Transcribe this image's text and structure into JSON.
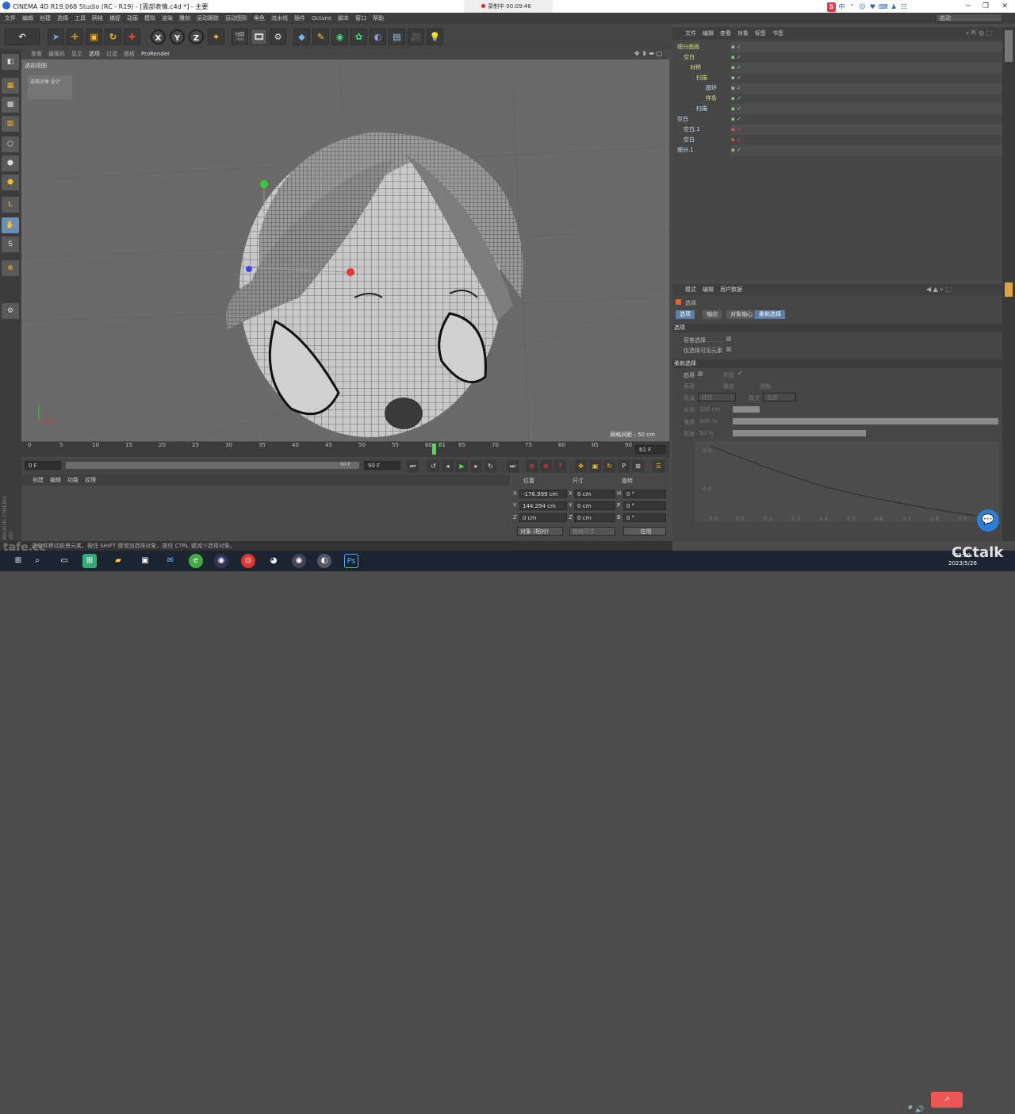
{
  "window": {
    "title": "CINEMA 4D R19.068 Studio (RC - R19) - [面部表情.c4d *] - 主要",
    "recording": "录制中 00:09:46"
  },
  "ime": {
    "items": [
      "S",
      "中",
      "°",
      "☺",
      "♥",
      "⌨",
      "♟",
      "☷",
      "☺"
    ]
  },
  "menu": [
    "文件",
    "编辑",
    "创建",
    "选择",
    "工具",
    "网格",
    "捕捉",
    "动画",
    "模拟",
    "渲染",
    "雕刻",
    "运动跟踪",
    "运动图形",
    "角色",
    "流水线",
    "插件",
    "Octane",
    "脚本",
    "窗口",
    "帮助"
  ],
  "layout_label": "启动",
  "toolbar": {
    "x": "X",
    "y": "Y",
    "z": "Z"
  },
  "viewport": {
    "menu": [
      "查看",
      "摄像机",
      "显示",
      "选项",
      "过滤",
      "面板",
      "ProRender"
    ],
    "active_menu": "选项",
    "label": "透视视图",
    "select_box": "选取对象 全计",
    "grid": "网格间距 : 50 cm"
  },
  "timeline": {
    "ticks": [
      "0",
      "5",
      "10",
      "15",
      "20",
      "25",
      "30",
      "35",
      "40",
      "45",
      "50",
      "55",
      "60",
      "61",
      "65",
      "70",
      "75",
      "80",
      "85",
      "90"
    ],
    "current": "61 F",
    "start": "0 F",
    "end": "90 F",
    "range_end": "90 F"
  },
  "bottom": {
    "tabs": [
      "创建",
      "编辑",
      "功能",
      "纹理"
    ]
  },
  "coords": {
    "headers": [
      "位置",
      "尺寸",
      "旋转"
    ],
    "pos": [
      "-176.999 cm",
      "144.294 cm",
      "0 cm"
    ],
    "size": [
      "0 cm",
      "0 cm",
      "0 cm"
    ],
    "rot": [
      "0 °",
      "0 °",
      "0 °"
    ],
    "axes": [
      "X",
      "Y",
      "Z"
    ],
    "rot_axes": [
      "H",
      "P",
      "B"
    ],
    "mode": "对象 (相对)",
    "size_mode": "绝对尺寸",
    "apply": "应用"
  },
  "status": "选取并移动前景元素，按住 SHIFT 键增加选择对象，按住 CTRL 键减少选择对象。",
  "objects": {
    "tabs": [
      "文件",
      "编辑",
      "查看",
      "对象",
      "标签",
      "书签"
    ],
    "rows": [
      {
        "name": "细分曲面",
        "indent": 0
      },
      {
        "name": "空白",
        "indent": 1
      },
      {
        "name": "对称",
        "indent": 2
      },
      {
        "name": "扫描",
        "indent": 3
      },
      {
        "name": "圆环",
        "indent": 4
      },
      {
        "name": "样条",
        "indent": 4
      },
      {
        "name": "扫描",
        "indent": 3
      },
      {
        "name": "空白",
        "indent": 0
      },
      {
        "name": "空白.1",
        "indent": 1
      },
      {
        "name": "空白",
        "indent": 1
      },
      {
        "name": "细分.1",
        "indent": 0
      }
    ]
  },
  "attributes": {
    "tabs": [
      "模式",
      "编辑",
      "用户数据"
    ],
    "title": "选择",
    "subtabs": [
      "选项",
      "轴向",
      "对象轴心",
      "柔和选择"
    ],
    "active_subtab": "柔和选择",
    "section1": "选项",
    "opt1": "容差选择 . . . . .",
    "opt2": "仅选择可见元素",
    "section2": "柔和选择",
    "r1": [
      "启用",
      "预览"
    ],
    "r2": [
      "表面",
      "橡皮",
      "限制"
    ],
    "mode": "模式",
    "mode_val": "全部",
    "falloff": "衰减",
    "falloff_val": "线性",
    "radius": "半径",
    "radius_val": "100 cm",
    "strength": "强度",
    "strength_val": "100 %",
    "width": "宽度",
    "width_val": "50 %",
    "strength_fill": 1.0,
    "width_fill": 0.5,
    "graph_y": [
      "0.8",
      "0.4"
    ],
    "graph_x": [
      "0.0",
      "0.1",
      "0.2",
      "0.3",
      "0.4",
      "0.5",
      "0.6",
      "0.7",
      "0.8",
      "0.9"
    ]
  },
  "taskbar": {
    "time": "20:50",
    "date": "2023/5/26"
  },
  "watermark_left": "tafe.cc",
  "watermark_right": "CCtalk"
}
